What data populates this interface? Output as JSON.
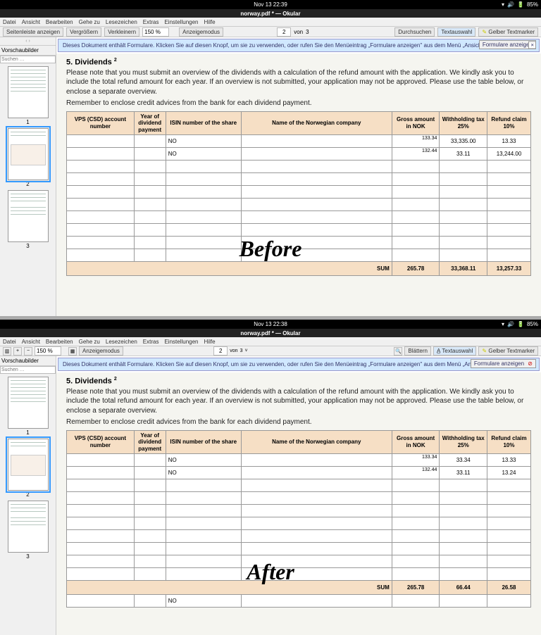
{
  "topbar": {
    "time_before": "Nov 13  22:39",
    "time_after": "Nov 13  22:38",
    "battery": "85%"
  },
  "title": "norway.pdf * — Okular",
  "menu": [
    "Datei",
    "Ansicht",
    "Bearbeiten",
    "Gehe zu",
    "Lesezeichen",
    "Extras",
    "Einstellungen",
    "Hilfe"
  ],
  "toolbar_before": {
    "seitenleiste": "Seitenleiste anzeigen",
    "vergroessern": "Vergrößern",
    "verkleinern": "Verkleinern",
    "zoom": "150 %",
    "anzeigemodus": "Anzeigemodus",
    "page": "2",
    "von": "von",
    "total": "3",
    "durchsuchen": "Durchsuchen",
    "textauswahl": "Textauswahl",
    "marker": "Gelber Textmarker"
  },
  "toolbar_after": {
    "zoom": "150 %",
    "anzeigemodus": "Anzeigemodus",
    "page": "2",
    "von": "von",
    "total": "3",
    "blaettern": "Blättern",
    "textauswahl": "Textauswahl",
    "marker": "Gelber Textmarker"
  },
  "sidebar": {
    "title": "Vorschaubilder",
    "search_ph": "Suchen …"
  },
  "banner": {
    "text": "Dieses Dokument enthält Formulare. Klicken Sie auf diesen Knopf, um sie zu verwenden, oder rufen Sie den Menüeintrag „Formulare anzeigen\" aus dem Menü „Ansicht\" auf.",
    "button": "Formulare anzeigen"
  },
  "doc": {
    "heading": "5. Dividends",
    "sup": "2",
    "para": "Please note that you must submit an overview of the dividends with a calculation of the refund amount with the application. We kindly ask you to include the total refund amount for each year. If an overview is not submitted, your application may not be approved. Please use the table below, or enclose a separate overview.",
    "para2": "Remember to enclose credit advices from the bank for each dividend payment.",
    "headers": [
      "VPS (CSD)\naccount number",
      "Year of\ndividend\npayment",
      "ISIN number of the share",
      "Name of the\nNorwegian company",
      "Gross amount\nin NOK",
      "Withholding tax\n25%",
      "Refund claim\n10%"
    ],
    "sum_label": "SUM"
  },
  "before": {
    "rows": [
      [
        "",
        "",
        "NO",
        "",
        "133.34",
        "33,335.00",
        "13.33"
      ],
      [
        "",
        "",
        "NO",
        "",
        "132.44",
        "33.11",
        "13,244.00"
      ]
    ],
    "sum": [
      "265.78",
      "33,368.11",
      "13,257.33"
    ],
    "label": "Before"
  },
  "after": {
    "rows": [
      [
        "",
        "",
        "NO",
        "",
        "133.34",
        "33.34",
        "13.33"
      ],
      [
        "",
        "",
        "NO",
        "",
        "132.44",
        "33.11",
        "13.24"
      ]
    ],
    "sum": [
      "265.78",
      "66.44",
      "26.58"
    ],
    "label": "After"
  }
}
